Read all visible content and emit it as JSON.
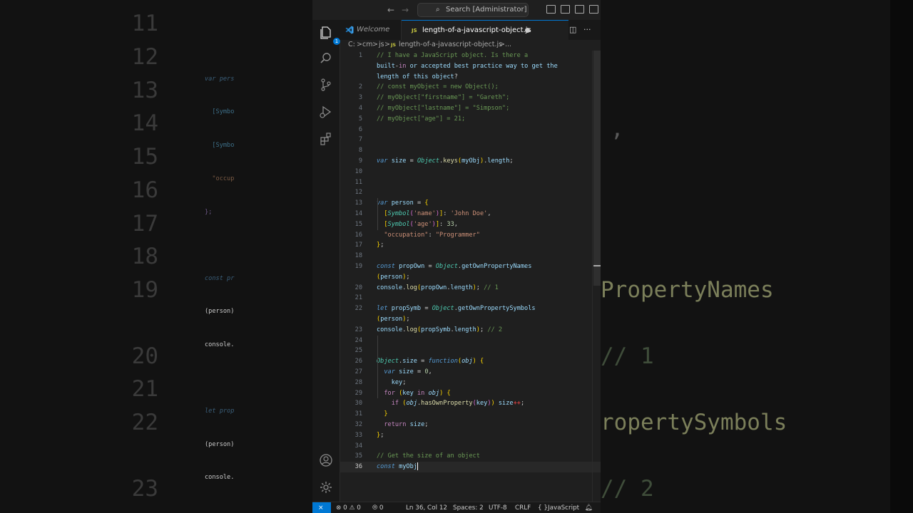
{
  "titlebar": {
    "search_text": "Search [Administrator]"
  },
  "activity_bar": {
    "explorer_badge": "1"
  },
  "tabs": [
    {
      "label": "Welcome"
    },
    {
      "icon_text": "JS",
      "label": "length-of-a-javascript-object.js"
    }
  ],
  "breadcrumb": {
    "drive": "C:",
    "sep": ">",
    "folder1": "cm",
    "folder2": "js",
    "file_icon": "JS",
    "file": "length-of-a-javascript-object.js",
    "ellipsis": "..."
  },
  "editor": {
    "lines": [
      {
        "n": "1",
        "t": "// I have a JavaScript object. Is there a"
      },
      {
        "n": "",
        "t": "built-in or accepted best practice way to get the"
      },
      {
        "n": "",
        "t": "length of this object?"
      },
      {
        "n": "2",
        "t": "// const myObject = new Object();"
      },
      {
        "n": "3",
        "t": "// myObject[\"firstname\"] = \"Gareth\";"
      },
      {
        "n": "4",
        "t": "// myObject[\"lastname\"] = \"Simpson\";"
      },
      {
        "n": "5",
        "t": "// myObject[\"age\"] = 21;"
      },
      {
        "n": "6",
        "t": ""
      },
      {
        "n": "7",
        "t": ""
      },
      {
        "n": "8",
        "t": ""
      },
      {
        "n": "9",
        "t": "var size = Object.keys(myObj).length;"
      },
      {
        "n": "10",
        "t": ""
      },
      {
        "n": "11",
        "t": ""
      },
      {
        "n": "12",
        "t": ""
      },
      {
        "n": "13",
        "t": "var person = {"
      },
      {
        "n": "14",
        "t": "  [Symbol('name')]: 'John Doe',"
      },
      {
        "n": "15",
        "t": "  [Symbol('age')]: 33,"
      },
      {
        "n": "16",
        "t": "  \"occupation\": \"Programmer\""
      },
      {
        "n": "17",
        "t": "};"
      },
      {
        "n": "18",
        "t": ""
      },
      {
        "n": "19",
        "t": "const propOwn = Object.getOwnPropertyNames"
      },
      {
        "n": "",
        "t": "(person);"
      },
      {
        "n": "20",
        "t": "console.log(propOwn.length); // 1"
      },
      {
        "n": "21",
        "t": ""
      },
      {
        "n": "22",
        "t": "let propSymb = Object.getOwnPropertySymbols"
      },
      {
        "n": "",
        "t": "(person);"
      },
      {
        "n": "23",
        "t": "console.log(propSymb.length); // 2"
      },
      {
        "n": "24",
        "t": ""
      },
      {
        "n": "25",
        "t": ""
      },
      {
        "n": "26",
        "t": "Object.size = function(obj) {"
      },
      {
        "n": "27",
        "t": "  var size = 0,"
      },
      {
        "n": "28",
        "t": "    key;"
      },
      {
        "n": "29",
        "t": "  for (key in obj) {"
      },
      {
        "n": "30",
        "t": "    if (obj.hasOwnProperty(key)) size++;"
      },
      {
        "n": "31",
        "t": "  }"
      },
      {
        "n": "32",
        "t": "  return size;"
      },
      {
        "n": "33",
        "t": "};"
      },
      {
        "n": "34",
        "t": ""
      },
      {
        "n": "35",
        "t": "// Get the size of an object"
      },
      {
        "n": "36",
        "t": "const myObj"
      }
    ]
  },
  "background_zoom": {
    "left": [
      {
        "n": "11",
        "t": ""
      },
      {
        "n": "12",
        "t": ""
      },
      {
        "n": "13",
        "t": "var pers"
      },
      {
        "n": "14",
        "t": "  [Symbo"
      },
      {
        "n": "15",
        "t": "  [Symbo"
      },
      {
        "n": "16",
        "t": "  \"occup"
      },
      {
        "n": "17",
        "t": "};"
      },
      {
        "n": "18",
        "t": ""
      },
      {
        "n": "19",
        "t": "const pr"
      },
      {
        "n": "",
        "t": "(person)"
      },
      {
        "n": "20",
        "t": "console."
      },
      {
        "n": "21",
        "t": ""
      },
      {
        "n": "22",
        "t": "let prop"
      },
      {
        "n": "",
        "t": "(person)"
      },
      {
        "n": "23",
        "t": "console."
      }
    ],
    "right": [
      {
        "t": ","
      },
      {
        "t": "PropertyNames"
      },
      {
        "t": "// 1"
      },
      {
        "t": "ropertySymbols"
      },
      {
        "t": "// 2"
      }
    ]
  },
  "statusbar": {
    "errors": "0",
    "warnings": "0",
    "ports": "0",
    "position": "Ln 36, Col 12",
    "spaces": "Spaces: 2",
    "encoding": "UTF-8",
    "eol": "CRLF",
    "language_icon": "{ }",
    "language": "JavaScript"
  },
  "colors": {
    "accent": "#0078d4",
    "editor_bg": "#1f1f1f",
    "sidebar_bg": "#181818"
  }
}
